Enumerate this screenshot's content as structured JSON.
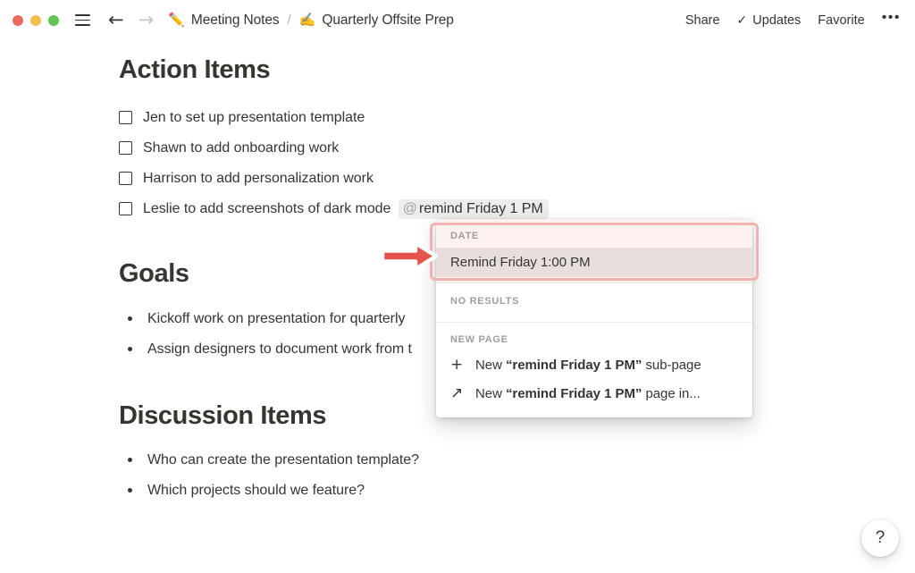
{
  "titlebar": {
    "traffic_lights": [
      "close",
      "minimize",
      "zoom"
    ],
    "menu_icon": "hamburger-icon",
    "back_label": "←",
    "forward_label": "→",
    "breadcrumb": [
      {
        "emoji": "✏️",
        "label": "Meeting Notes"
      },
      {
        "emoji": "✍️",
        "label": "Quarterly Offsite Prep"
      }
    ],
    "separator": "/",
    "actions": {
      "share": "Share",
      "updates": "Updates",
      "updates_check": "✓",
      "favorite": "Favorite",
      "more": "•••"
    }
  },
  "document": {
    "sections": [
      {
        "heading": "Action Items",
        "type": "todo",
        "items": [
          {
            "text": "Jen to set up presentation template",
            "checked": false
          },
          {
            "text": "Shawn to add onboarding work",
            "checked": false
          },
          {
            "text": "Harrison to add personalization work",
            "checked": false
          },
          {
            "text": "Leslie to add screenshots of dark mode ",
            "checked": false,
            "mention_at": "@",
            "mention": "remind Friday 1 PM"
          }
        ]
      },
      {
        "heading": "Goals",
        "type": "bullets",
        "items": [
          {
            "text": "Kickoff work on presentation for quarterly"
          },
          {
            "text": "Assign designers to document work from t"
          }
        ]
      },
      {
        "heading": "Discussion Items",
        "type": "bullets",
        "items": [
          {
            "text": "Who can create the presentation template?"
          },
          {
            "text": "Which projects should we feature?"
          }
        ]
      }
    ]
  },
  "mention_popup": {
    "groups": {
      "date": {
        "label": "DATE",
        "option": "Remind Friday 1:00 PM",
        "selected": true
      },
      "no_results": {
        "label": "NO RESULTS"
      },
      "new_page": {
        "label": "NEW PAGE",
        "rows": [
          {
            "glyph": "+",
            "prefix": "New ",
            "quoted": "“remind Friday 1 PM”",
            "suffix": " sub-page"
          },
          {
            "glyph": "↗",
            "prefix": "New ",
            "quoted": "“remind Friday 1 PM”",
            "suffix": " page in..."
          }
        ]
      }
    }
  },
  "annotations": {
    "arrow": "red-right-arrow",
    "highlight": "red-rounded-rectangle",
    "highlight_color": "#f1b2ad",
    "arrow_color": "#e4534c"
  },
  "help_button": {
    "glyph": "?"
  },
  "colors": {
    "text": "#37352f",
    "muted": "#a09e9a",
    "mention_bg": "#ededeb",
    "selected_row_bg": "#e8dedc",
    "date_group_bg": "#fdf1f0",
    "traffic_red": "#ec6a5f",
    "traffic_yellow": "#f5bf4f",
    "traffic_green": "#62c554"
  }
}
